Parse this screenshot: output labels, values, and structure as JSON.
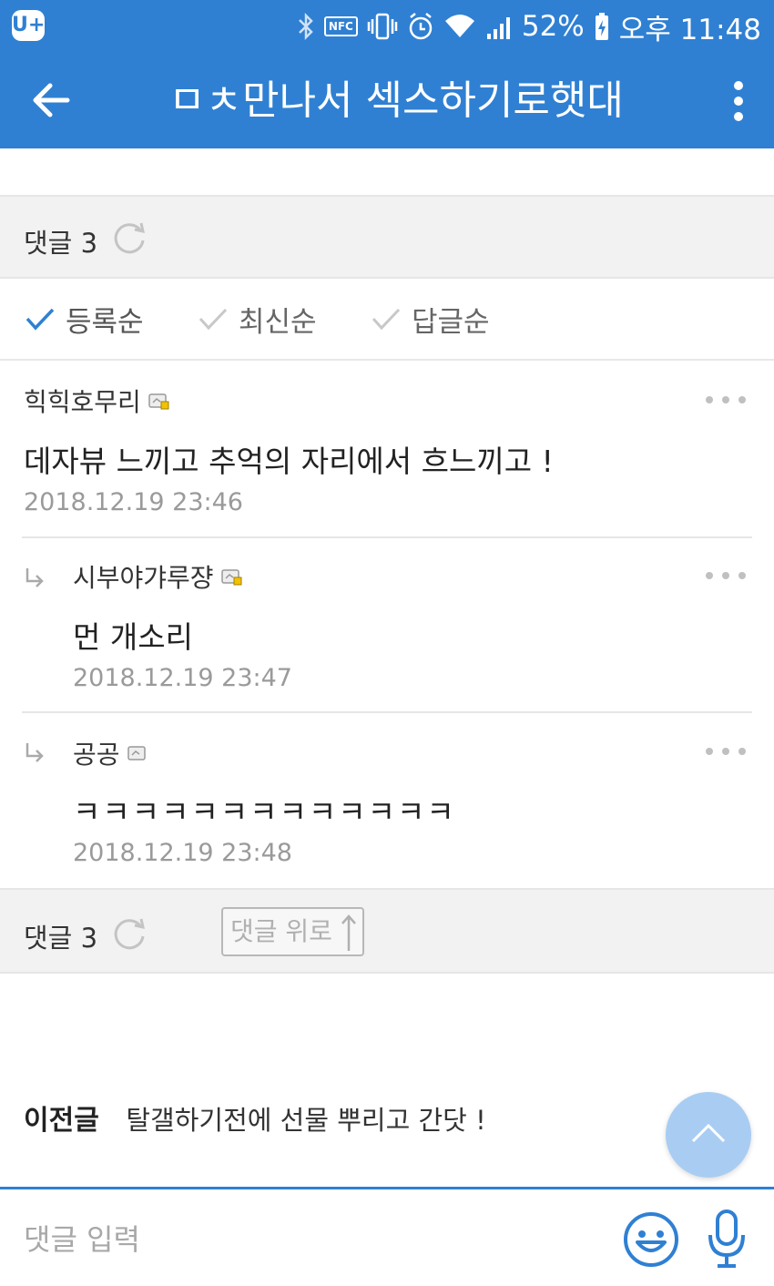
{
  "status": {
    "app_logo": "U+",
    "nfc": "NFC",
    "battery": "52%",
    "time": "오후 11:48",
    "icons": [
      "bluetooth-icon",
      "nfc-icon",
      "vibrate-icon",
      "alarm-icon",
      "wifi-icon",
      "signal-icon",
      "battery-icon"
    ]
  },
  "header": {
    "title": "ㅁㅊ만나서 섹스하기로햇대"
  },
  "comments_header": {
    "label": "댓글 3"
  },
  "sort": {
    "options": [
      {
        "label": "등록순",
        "active": true
      },
      {
        "label": "최신순",
        "active": false
      },
      {
        "label": "답글순",
        "active": false
      }
    ]
  },
  "comments": [
    {
      "author": "힉힉호무리",
      "text": "데자뷰 느끼고 추억의 자리에서 흐느끼고 !",
      "date": "2018.12.19 23:46",
      "reply": false
    },
    {
      "author": "시부야갸루쟝",
      "text": "먼 개소리",
      "date": "2018.12.19 23:47",
      "reply": true
    },
    {
      "author": "공공",
      "text": "ㅋㅋㅋㅋㅋㅋㅋㅋㅋㅋㅋㅋㅋ",
      "date": "2018.12.19 23:48",
      "reply": true
    }
  ],
  "comments_footer": {
    "label": "댓글 3",
    "scroll_up_label": "댓글 위로"
  },
  "prev_post": {
    "label": "이전글",
    "title": "탈갤하기전에  선물 뿌리고 간닷 !"
  },
  "input": {
    "placeholder": "댓글 입력"
  },
  "colors": {
    "accent": "#2f80d3",
    "fab": "#a9cdf2"
  }
}
